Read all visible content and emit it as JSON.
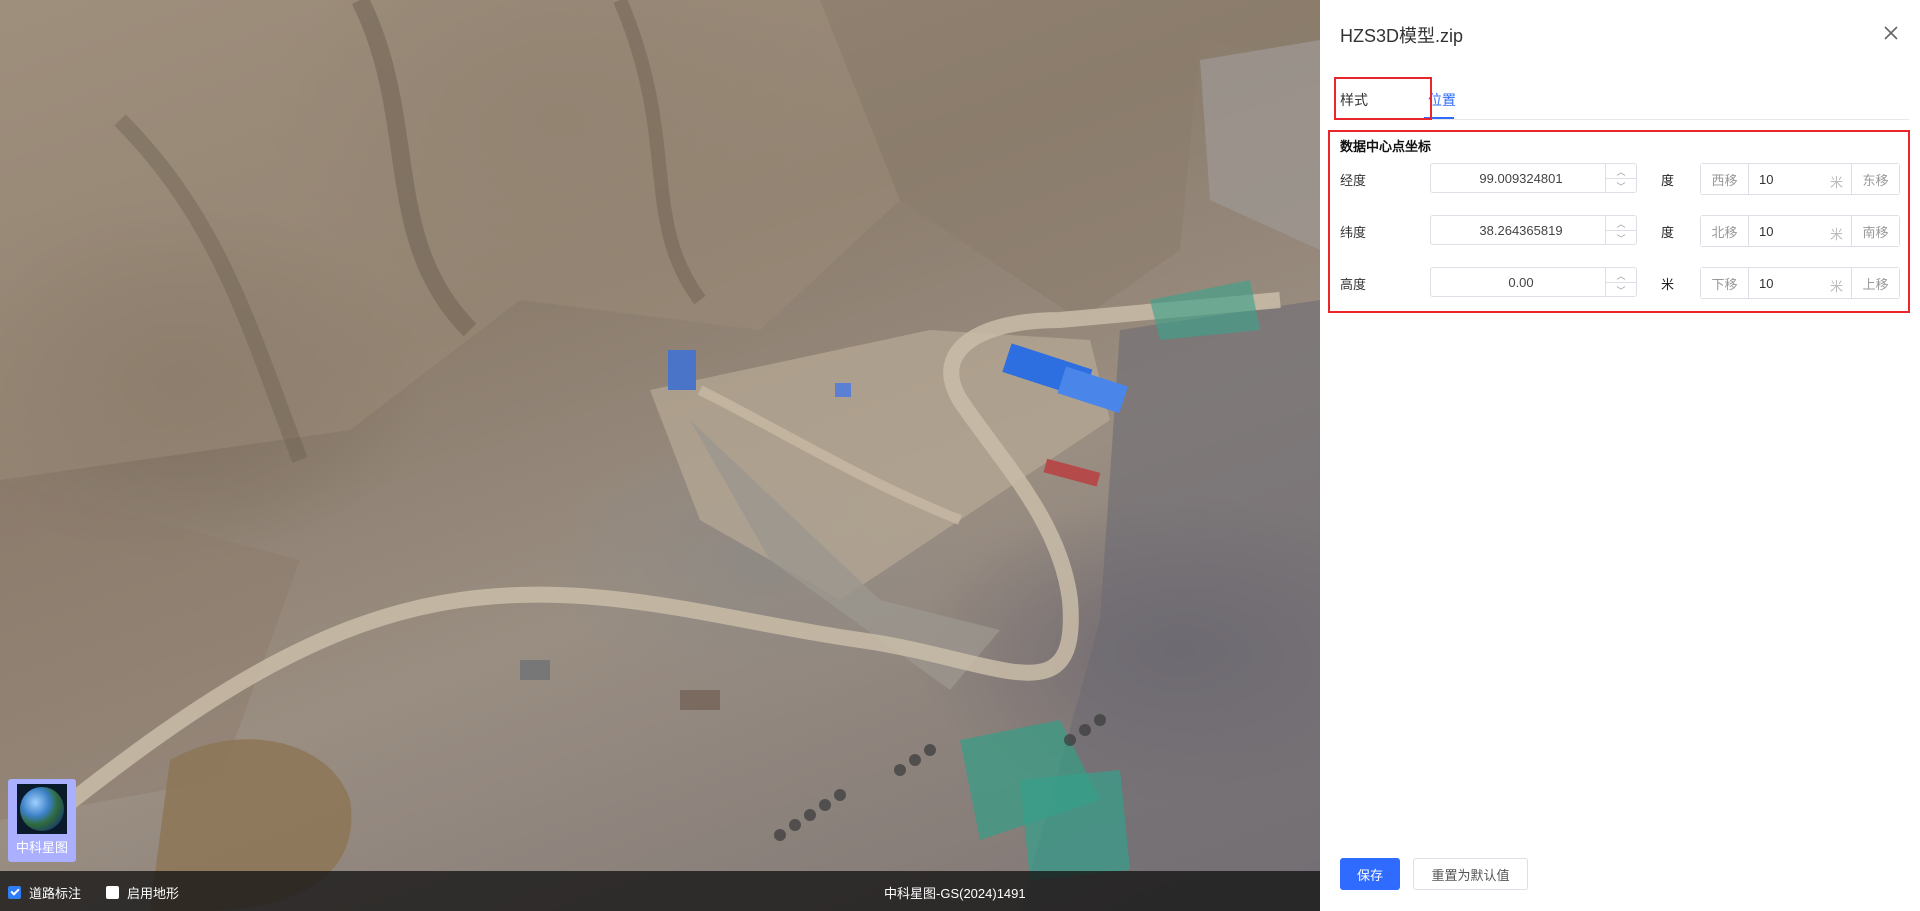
{
  "map": {
    "layer_thumb_label": "中科星图",
    "bottom_bar": {
      "road_label": "道路标注",
      "road_checked": true,
      "terrain_label": "启用地形",
      "terrain_checked": false,
      "copyright": "中科星图-GS(2024)1491"
    }
  },
  "panel": {
    "title": "HZS3D模型.zip",
    "tabs": [
      {
        "label": "样式",
        "active": false
      },
      {
        "label": "位置",
        "active": true
      }
    ],
    "section_title": "数据中心点坐标",
    "rows": [
      {
        "label": "经度",
        "value": "99.009324801",
        "unit": "度",
        "minus_label": "西移",
        "step": "10",
        "step_unit": "米",
        "plus_label": "东移"
      },
      {
        "label": "纬度",
        "value": "38.264365819",
        "unit": "度",
        "minus_label": "北移",
        "step": "10",
        "step_unit": "米",
        "plus_label": "南移"
      },
      {
        "label": "高度",
        "value": "0.00",
        "unit": "米",
        "minus_label": "下移",
        "step": "10",
        "step_unit": "米",
        "plus_label": "上移"
      }
    ],
    "save_label": "保存",
    "reset_label": "重置为默认值"
  },
  "colors": {
    "accent": "#2f6bff",
    "highlight": "#e8262b"
  }
}
